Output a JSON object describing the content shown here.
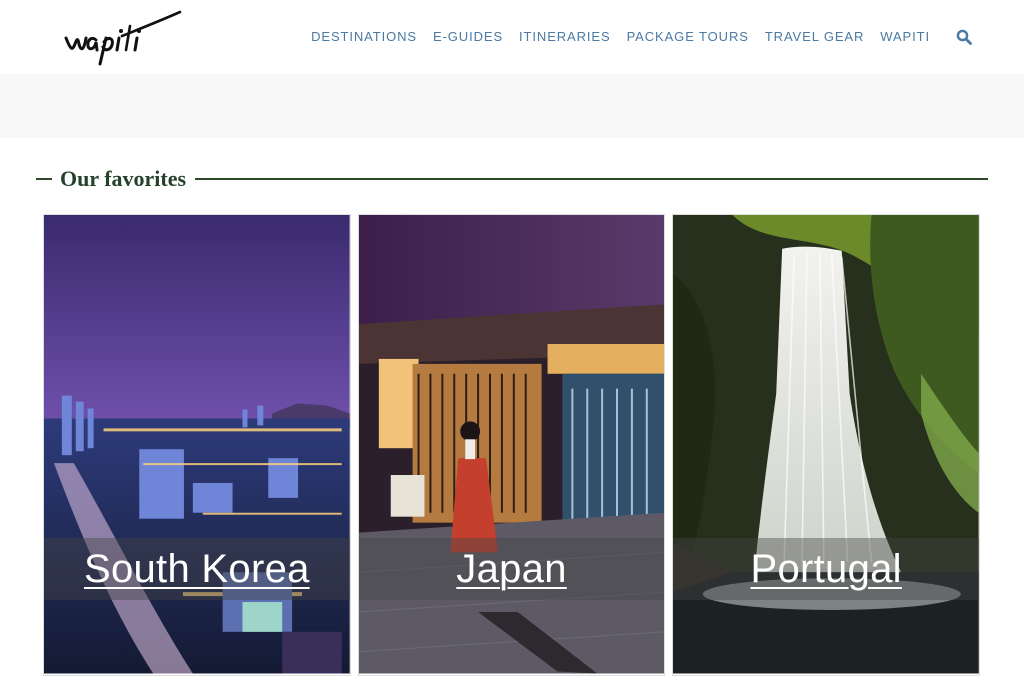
{
  "header": {
    "logo_text": "wapiti",
    "nav": [
      {
        "label": "DESTINATIONS"
      },
      {
        "label": "E-GUIDES"
      },
      {
        "label": "ITINERARIES"
      },
      {
        "label": "PACKAGE TOURS"
      },
      {
        "label": "TRAVEL GEAR"
      },
      {
        "label": "WAPITI"
      }
    ],
    "search_icon": "search-icon"
  },
  "section": {
    "title": "Our favorites"
  },
  "cards": [
    {
      "label": "South Korea",
      "image": "night-city-skyline-photo"
    },
    {
      "label": "Japan",
      "image": "geisha-street-night-photo"
    },
    {
      "label": "Portugal",
      "image": "waterfall-forest-photo"
    }
  ],
  "colors": {
    "nav_link": "#4a79a3",
    "title_green": "#25412a",
    "band": "#f8f8f8"
  }
}
